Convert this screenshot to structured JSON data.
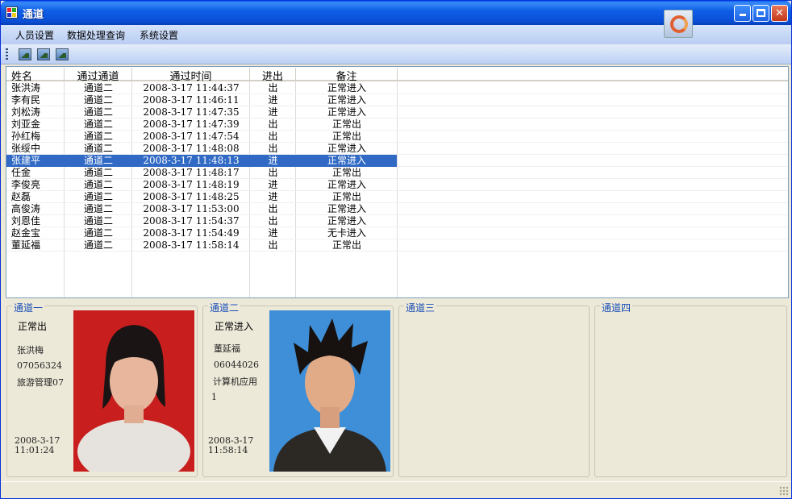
{
  "window": {
    "title": "通道",
    "icon": "app-window-icon",
    "badge_icon": "app-logo-badge-icon",
    "controls": [
      "minimize-icon",
      "maximize-icon",
      "close-icon"
    ]
  },
  "menu": {
    "items": [
      "人员设置",
      "数据处理查询",
      "系统设置"
    ]
  },
  "toolbar": {
    "icons": [
      "picture-icon",
      "picture-icon",
      "picture-icon"
    ]
  },
  "grid": {
    "columns": [
      "姓名",
      "通过通道",
      "通过时间",
      "进出",
      "备注"
    ],
    "selected_index": 6,
    "selection_color": "#316ac5",
    "rows": [
      {
        "name": "张洪涛",
        "channel": "通道二",
        "time": "2008-3-17  11:44:37",
        "io": "出",
        "note": "正常进入"
      },
      {
        "name": "李有民",
        "channel": "通道二",
        "time": "2008-3-17  11:46:11",
        "io": "进",
        "note": "正常进入"
      },
      {
        "name": "刘松涛",
        "channel": "通道二",
        "time": "2008-3-17  11:47:35",
        "io": "进",
        "note": "正常进入"
      },
      {
        "name": "刘亚金",
        "channel": "通道二",
        "time": "2008-3-17  11:47:39",
        "io": "出",
        "note": "正常出"
      },
      {
        "name": "孙红梅",
        "channel": "通道二",
        "time": "2008-3-17  11:47:54",
        "io": "出",
        "note": "正常出"
      },
      {
        "name": "张绥中",
        "channel": "通道二",
        "time": "2008-3-17  11:48:08",
        "io": "出",
        "note": "正常进入"
      },
      {
        "name": "张建平",
        "channel": "通道二",
        "time": "2008-3-17  11:48:13",
        "io": "进",
        "note": "正常进入"
      },
      {
        "name": "任金",
        "channel": "通道二",
        "time": "2008-3-17  11:48:17",
        "io": "出",
        "note": "正常出"
      },
      {
        "name": "李俊亮",
        "channel": "通道二",
        "time": "2008-3-17  11:48:19",
        "io": "进",
        "note": "正常进入"
      },
      {
        "name": "赵磊",
        "channel": "通道二",
        "time": "2008-3-17  11:48:25",
        "io": "进",
        "note": "正常出"
      },
      {
        "name": "高俊涛",
        "channel": "通道二",
        "time": "2008-3-17  11:53:00",
        "io": "出",
        "note": "正常进入"
      },
      {
        "name": "刘恩佳",
        "channel": "通道二",
        "time": "2008-3-17  11:54:37",
        "io": "出",
        "note": "正常进入"
      },
      {
        "name": "赵金宝",
        "channel": "通道二",
        "time": "2008-3-17  11:54:49",
        "io": "进",
        "note": "无卡进入"
      },
      {
        "name": "董延福",
        "channel": "通道二",
        "time": "2008-3-17  11:58:14",
        "io": "出",
        "note": "正常出"
      }
    ]
  },
  "panels": [
    {
      "title": "通道一",
      "status": "正常出",
      "name": "张洪梅",
      "id": "07056324",
      "dept": "旅游管理07",
      "extra": "",
      "date": "2008-3-17",
      "time": "11:01:24",
      "photo_bg": "#c81e1e"
    },
    {
      "title": "通道二",
      "status": "正常进入",
      "name": "董延福",
      "id": "06044026",
      "dept": "计算机应用",
      "extra": "1",
      "date": "2008-3-17",
      "time": "11:58:14",
      "photo_bg": "#3f8fd8"
    },
    {
      "title": "通道三"
    },
    {
      "title": "通道四"
    }
  ]
}
